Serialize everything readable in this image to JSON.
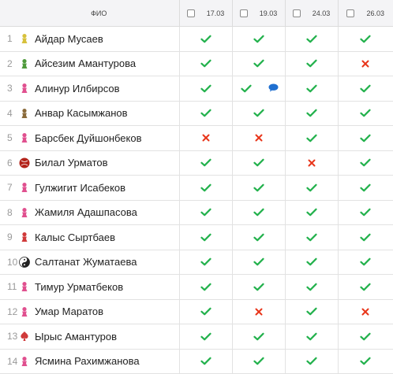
{
  "header": {
    "name_label": "ФИО",
    "dates": [
      "17.03",
      "19.03",
      "24.03",
      "26.03"
    ]
  },
  "colors": {
    "present": "#22b14c",
    "absent": "#e8351a",
    "comment": "#1f6fd0"
  },
  "rows": [
    {
      "n": "1",
      "name": "Айдар Мусаев",
      "avatar": "bust-icon",
      "avatar_color": "#d7c13b",
      "marks": [
        "present",
        "present",
        "present",
        "present"
      ]
    },
    {
      "n": "2",
      "name": "Айсезим Амантурова",
      "avatar": "bust-icon",
      "avatar_color": "#4f9a3b",
      "marks": [
        "present",
        "present",
        "present",
        "absent"
      ]
    },
    {
      "n": "3",
      "name": "Алинур Илбирсов",
      "avatar": "bust-icon",
      "avatar_color": "#e0508f",
      "marks": [
        "present",
        "present",
        "present",
        "present"
      ],
      "comment_on": 1
    },
    {
      "n": "4",
      "name": "Анвар Касымжанов",
      "avatar": "bust-icon",
      "avatar_color": "#8a6a3a",
      "marks": [
        "present",
        "present",
        "present",
        "present"
      ]
    },
    {
      "n": "5",
      "name": "Барсбек Дуйшонбеков",
      "avatar": "bust-icon",
      "avatar_color": "#e0508f",
      "marks": [
        "absent",
        "absent",
        "present",
        "present"
      ]
    },
    {
      "n": "6",
      "name": "Билал Урматов",
      "avatar": "ball-icon",
      "avatar_color": "#b3231a",
      "marks": [
        "present",
        "present",
        "absent",
        "present"
      ]
    },
    {
      "n": "7",
      "name": "Гулжигит Исабеков",
      "avatar": "bust-icon",
      "avatar_color": "#e0508f",
      "marks": [
        "present",
        "present",
        "present",
        "present"
      ]
    },
    {
      "n": "8",
      "name": "Жамиля Адашпасова",
      "avatar": "bust-icon",
      "avatar_color": "#e0508f",
      "marks": [
        "present",
        "present",
        "present",
        "present"
      ]
    },
    {
      "n": "9",
      "name": "Калыс Сыртбаев",
      "avatar": "bust-icon",
      "avatar_color": "#d03a3a",
      "marks": [
        "present",
        "present",
        "present",
        "present"
      ]
    },
    {
      "n": "10",
      "name": "Салтанат Жуматаева",
      "avatar": "yin-yang-icon",
      "avatar_color": "#222222",
      "marks": [
        "present",
        "present",
        "present",
        "present"
      ]
    },
    {
      "n": "11",
      "name": "Тимур Урматбеков",
      "avatar": "bust-icon",
      "avatar_color": "#e0508f",
      "marks": [
        "present",
        "present",
        "present",
        "present"
      ]
    },
    {
      "n": "12",
      "name": "Умар Маратов",
      "avatar": "bust-icon",
      "avatar_color": "#e0508f",
      "marks": [
        "present",
        "absent",
        "present",
        "absent"
      ]
    },
    {
      "n": "13",
      "name": "Ырыс Амантуров",
      "avatar": "spade-icon",
      "avatar_color": "#d03a3a",
      "marks": [
        "present",
        "present",
        "present",
        "present"
      ]
    },
    {
      "n": "14",
      "name": "Ясмина Рахимжанова",
      "avatar": "bust-icon",
      "avatar_color": "#e0508f",
      "marks": [
        "present",
        "present",
        "present",
        "present"
      ]
    }
  ]
}
